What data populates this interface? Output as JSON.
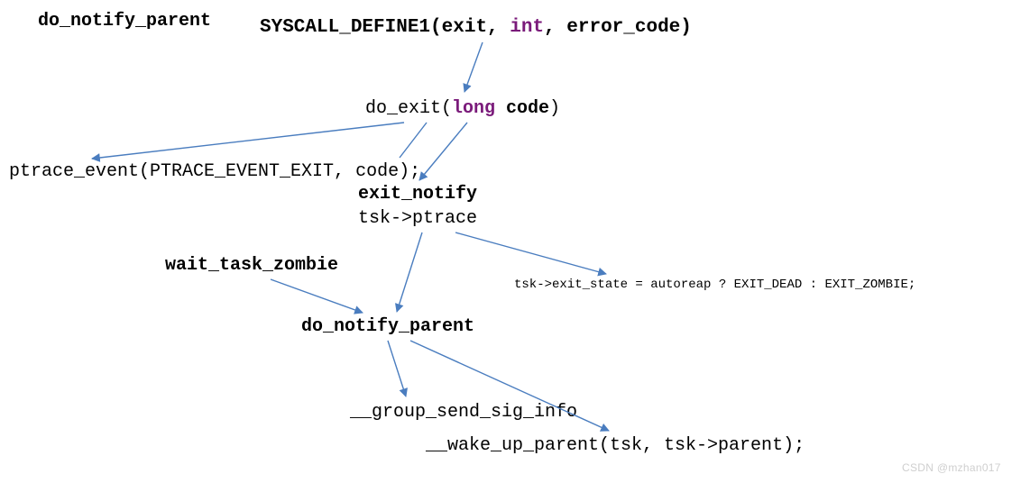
{
  "title": "do_notify_parent",
  "syscall": {
    "prefix": "SYSCALL_DEFINE1(exit, ",
    "kw": "int",
    "suffix": ", error_code)"
  },
  "do_exit": {
    "prefix": "do_exit(",
    "kw": "long",
    "mid": " code",
    "suffix": ")"
  },
  "ptrace_event": "ptrace_event(PTRACE_EVENT_EXIT, code);",
  "exit_notify": "exit_notify",
  "tsk_ptrace": "tsk->ptrace",
  "wait_task_zombie": "wait_task_zombie",
  "exit_state": "tsk->exit_state = autoreap ? EXIT_DEAD : EXIT_ZOMBIE;",
  "do_notify_parent": "do_notify_parent",
  "group_send_sig_info": "__group_send_sig_info",
  "wake_up_parent": "__wake_up_parent(tsk, tsk->parent);",
  "watermark": "CSDN @mzhan017",
  "arrow_color": "#4a7dbf"
}
